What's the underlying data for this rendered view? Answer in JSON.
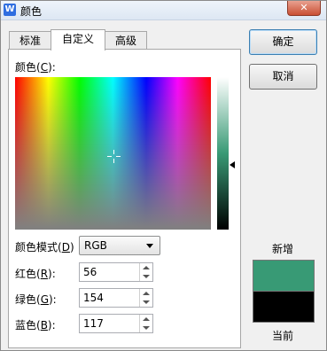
{
  "window": {
    "app_icon": "W",
    "title": "颜色",
    "close_glyph": "✕"
  },
  "tabs": [
    {
      "label": "标准",
      "active": false
    },
    {
      "label": "自定义",
      "active": true
    },
    {
      "label": "高级",
      "active": false
    }
  ],
  "colors_label": {
    "prefix": "颜色(",
    "hotkey": "C",
    "suffix": "):"
  },
  "color_model": {
    "label_prefix": "颜色模式(",
    "hotkey": "D",
    "label_suffix": ")",
    "value": "RGB"
  },
  "red": {
    "label_prefix": "红色(",
    "hotkey": "R",
    "label_suffix": "):",
    "value": "56"
  },
  "green": {
    "label_prefix": "绿色(",
    "hotkey": "G",
    "label_suffix": "):",
    "value": "154"
  },
  "blue": {
    "label_prefix": "蓝色(",
    "hotkey": "B",
    "label_suffix": "):",
    "value": "117"
  },
  "buttons": {
    "ok": "确定",
    "cancel": "取消"
  },
  "preview": {
    "new_label": "新增",
    "current_label": "当前",
    "new_color": "#389a75",
    "current_color": "#000000"
  }
}
